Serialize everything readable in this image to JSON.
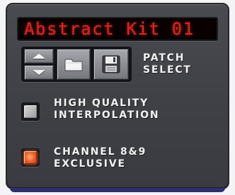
{
  "display": {
    "patch_name": "Abstract Kit 01"
  },
  "patch_select": {
    "label_line1": "PATCH",
    "label_line2": "SELECT",
    "buttons": {
      "previous": "arrow-up-icon",
      "next": "arrow-down-icon",
      "browse": "folder-icon",
      "save": "floppy-disk-icon"
    }
  },
  "high_quality_interpolation": {
    "label_line1": "HIGH QUALITY",
    "label_line2": "INTERPOLATION",
    "enabled": false
  },
  "channel_exclusive": {
    "label_line1": "CHANNEL 8&9",
    "label_line2": "EXCLUSIVE",
    "enabled": true
  },
  "colors": {
    "panel": "#414248",
    "lcd_text": "#ff2a1a",
    "led_on": "#f0622a",
    "led_off": "#c4c4c8"
  }
}
